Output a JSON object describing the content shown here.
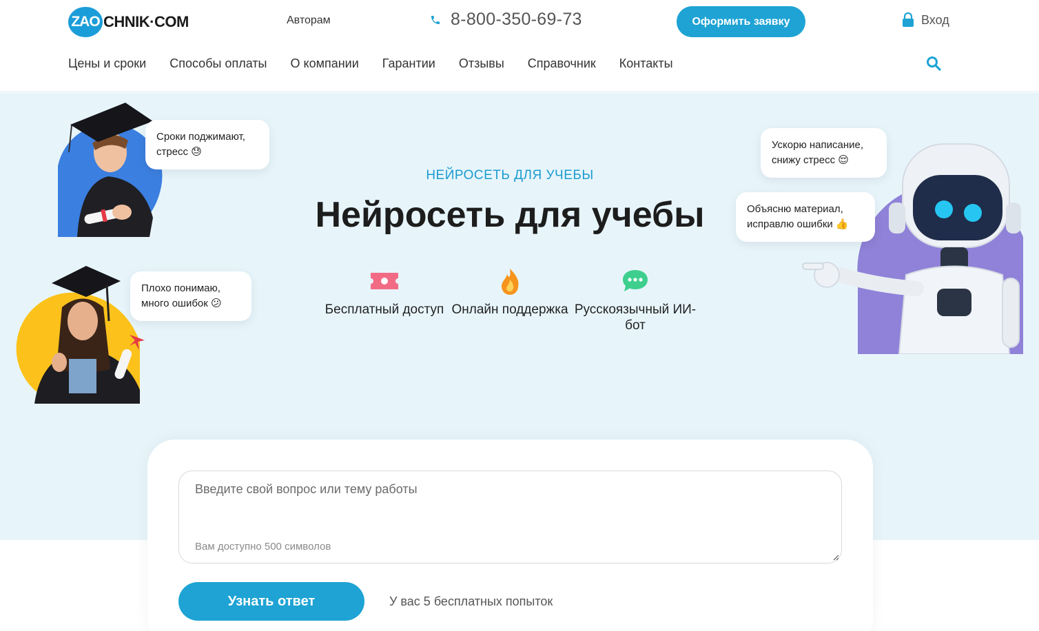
{
  "header": {
    "logo_prefix": "ZAO",
    "logo_rest": "CHNIK·COM",
    "authors_link": "Авторам",
    "phone": "8-800-350-69-73",
    "cta_label": "Оформить заявку",
    "login_label": "Вход",
    "nav": [
      "Цены и сроки",
      "Способы оплаты",
      "О компании",
      "Гарантии",
      "Отзывы",
      "Справочник",
      "Контакты"
    ]
  },
  "hero": {
    "subtitle": "НЕЙРОСЕТЬ ДЛЯ УЧЕБЫ",
    "title": "Нейросеть для учебы",
    "features": [
      {
        "label": "Бесплатный доступ",
        "icon": "ticket-icon"
      },
      {
        "label": "Онлайн поддержка",
        "icon": "fire-icon"
      },
      {
        "label": "Русскоязычный ИИ-бот",
        "icon": "chat-icon"
      }
    ],
    "bubbles": {
      "student_male": "Сроки поджимают, стресс 😓",
      "student_female": "Плохо понимаю, много ошибок 😕",
      "robot_top": "Ускорю написание, снижу стресс 😌",
      "robot_bottom": "Объясню материал, исправлю ошибки 👍"
    }
  },
  "form": {
    "placeholder": "Введите свой вопрос или тему работы",
    "chars_hint": "Вам доступно 500 символов",
    "submit_label": "Узнать ответ",
    "attempts": "У вас 5 бесплатных попыток"
  },
  "colors": {
    "accent": "#1ea3d4",
    "hero_bg": "#e7f5fb"
  }
}
